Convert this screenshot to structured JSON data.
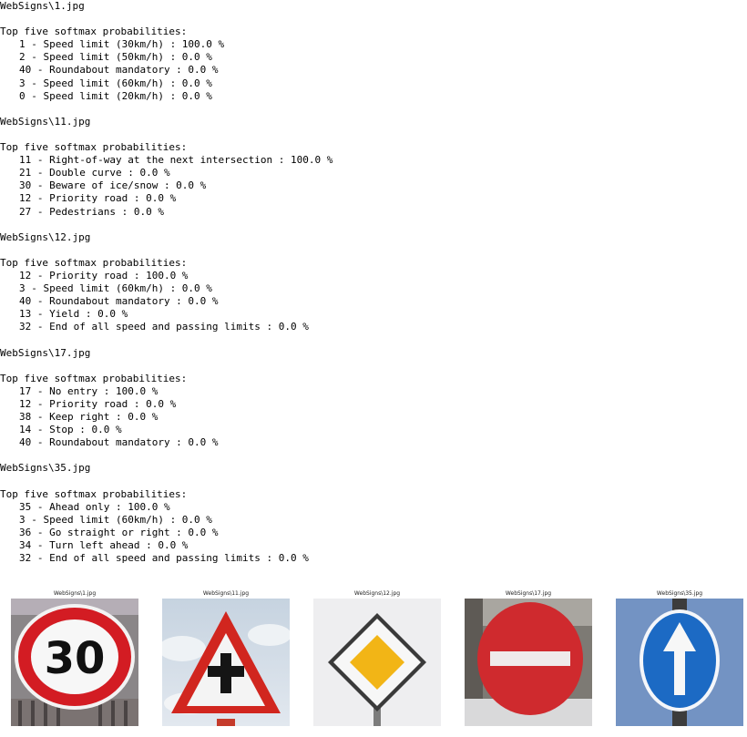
{
  "results": [
    {
      "file": "WebSigns\\1.jpg",
      "heading": "Top five softmax probabilities:",
      "items": [
        "1 - Speed limit (30km/h) : 100.0 %",
        "2 - Speed limit (50km/h) : 0.0 %",
        "40 - Roundabout mandatory : 0.0 %",
        "3 - Speed limit (60km/h) : 0.0 %",
        "0 - Speed limit (20km/h) : 0.0 %"
      ]
    },
    {
      "file": "WebSigns\\11.jpg",
      "heading": "Top five softmax probabilities:",
      "items": [
        "11 - Right-of-way at the next intersection : 100.0 %",
        "21 - Double curve : 0.0 %",
        "30 - Beware of ice/snow : 0.0 %",
        "12 - Priority road : 0.0 %",
        "27 - Pedestrians : 0.0 %"
      ]
    },
    {
      "file": "WebSigns\\12.jpg",
      "heading": "Top five softmax probabilities:",
      "items": [
        "12 - Priority road : 100.0 %",
        "3 - Speed limit (60km/h) : 0.0 %",
        "40 - Roundabout mandatory : 0.0 %",
        "13 - Yield : 0.0 %",
        "32 - End of all speed and passing limits : 0.0 %"
      ]
    },
    {
      "file": "WebSigns\\17.jpg",
      "heading": "Top five softmax probabilities:",
      "items": [
        "17 - No entry : 100.0 %",
        "12 - Priority road : 0.0 %",
        "38 - Keep right : 0.0 %",
        "14 - Stop : 0.0 %",
        "40 - Roundabout mandatory : 0.0 %"
      ]
    },
    {
      "file": "WebSigns\\35.jpg",
      "heading": "Top five softmax probabilities:",
      "items": [
        "35 - Ahead only : 100.0 %",
        "3 - Speed limit (60km/h) : 0.0 %",
        "36 - Go straight or right : 0.0 %",
        "34 - Turn left ahead : 0.0 %",
        "32 - End of all speed and passing limits : 0.0 %"
      ]
    }
  ],
  "thumbnails": [
    {
      "title": "WebSigns\\1.jpg",
      "sign": "speed-limit-30-sign",
      "text": "30"
    },
    {
      "title": "WebSigns\\11.jpg",
      "sign": "right-of-way-sign"
    },
    {
      "title": "WebSigns\\12.jpg",
      "sign": "priority-road-sign"
    },
    {
      "title": "WebSigns\\17.jpg",
      "sign": "no-entry-sign"
    },
    {
      "title": "WebSigns\\35.jpg",
      "sign": "ahead-only-sign"
    }
  ]
}
